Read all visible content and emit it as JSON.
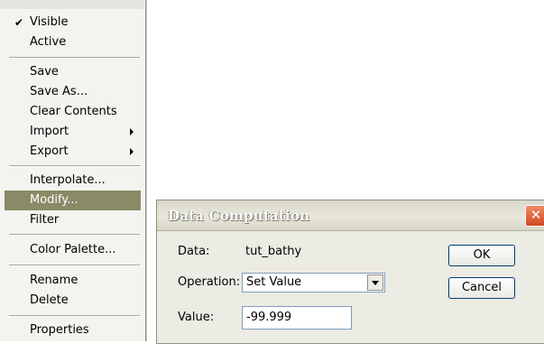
{
  "context_menu": {
    "items": [
      {
        "label": "Visible",
        "checked": true
      },
      {
        "label": "Active"
      },
      {
        "label": "Save"
      },
      {
        "label": "Save As..."
      },
      {
        "label": "Clear Contents"
      },
      {
        "label": "Import",
        "has_submenu": true
      },
      {
        "label": "Export",
        "has_submenu": true
      },
      {
        "label": "Interpolate..."
      },
      {
        "label": "Modify...",
        "highlighted": true
      },
      {
        "label": "Filter"
      },
      {
        "label": "Color Palette..."
      },
      {
        "label": "Rename"
      },
      {
        "label": "Delete"
      },
      {
        "label": "Properties"
      }
    ],
    "check_glyph": "✔",
    "highlight_color": "#8a8a66"
  },
  "dialog": {
    "title": "Data Computation",
    "close_glyph": "✕",
    "data_label": "Data:",
    "data_value": "tut_bathy",
    "operation_label": "Operation:",
    "operation_value": "Set Value",
    "value_label": "Value:",
    "value_input": "-99.999",
    "ok_label": "OK",
    "cancel_label": "Cancel"
  }
}
